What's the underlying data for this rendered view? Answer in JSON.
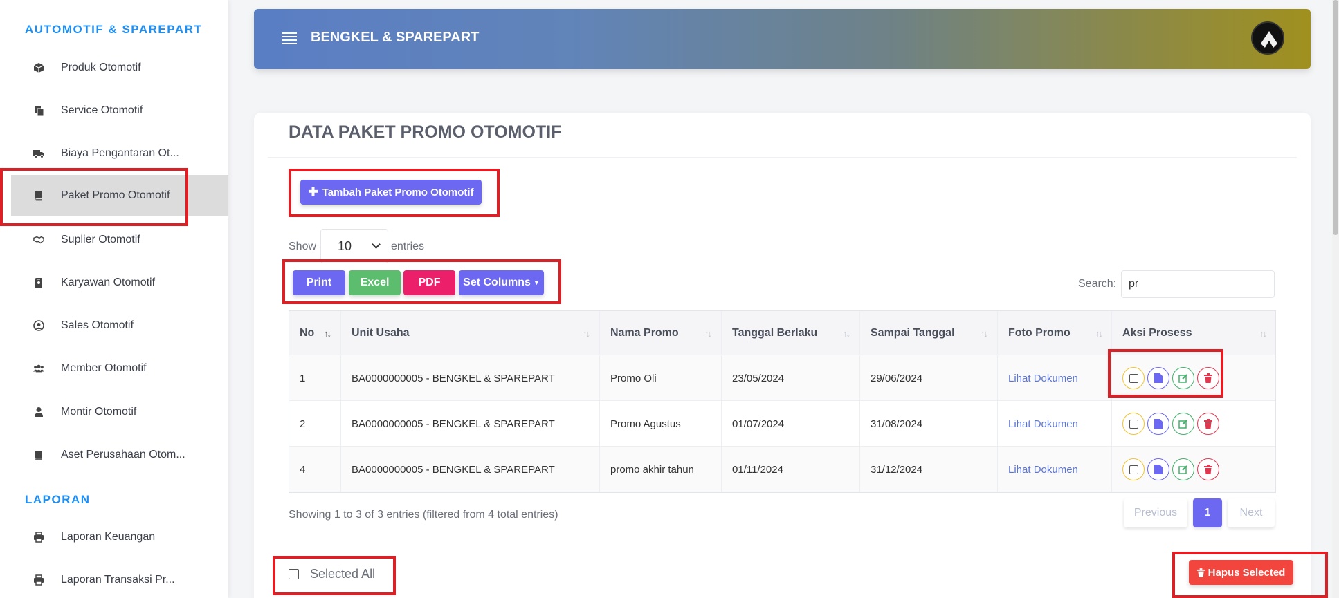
{
  "sidebar": {
    "sections": [
      {
        "title": "AUTOMOTIF & SPAREPART"
      },
      {
        "title": "LAPORAN"
      }
    ],
    "items": [
      {
        "label": "Produk Otomotif",
        "icon": "box-icon"
      },
      {
        "label": "Service Otomotif",
        "icon": "copy-icon"
      },
      {
        "label": "Biaya Pengantaran Ot...",
        "icon": "truck-icon"
      },
      {
        "label": "Paket Promo Otomotif",
        "icon": "book-icon"
      },
      {
        "label": "Suplier Otomotif",
        "icon": "handshake-icon"
      },
      {
        "label": "Karyawan Otomotif",
        "icon": "id-badge-icon"
      },
      {
        "label": "Sales Otomotif",
        "icon": "user-circle-icon"
      },
      {
        "label": "Member Otomotif",
        "icon": "users-icon"
      },
      {
        "label": "Montir Otomotif",
        "icon": "user-icon"
      },
      {
        "label": "Aset Perusahaan Otom...",
        "icon": "book-icon"
      },
      {
        "label": "Laporan Keuangan",
        "icon": "print-icon"
      },
      {
        "label": "Laporan Transaksi Pr...",
        "icon": "print-icon"
      }
    ]
  },
  "header": {
    "brand": "BENGKEL & SPAREPART"
  },
  "card": {
    "title": "DATA PAKET PROMO OTOMOTIF",
    "add_button": "Tambah Paket Promo Otomotif",
    "show_label": "Show",
    "entries_label": "entries",
    "entries_value": "10",
    "export": {
      "print": "Print",
      "excel": "Excel",
      "pdf": "PDF",
      "columns": "Set Columns"
    },
    "search_label": "Search:",
    "search_value": "pr",
    "columns": [
      "No",
      "Unit Usaha",
      "Nama Promo",
      "Tanggal Berlaku",
      "Sampai Tanggal",
      "Foto Promo",
      "Aksi Prosess"
    ],
    "rows": [
      {
        "no": "1",
        "unit": "BA0000000005 - BENGKEL & SPAREPART",
        "nama": "Promo Oli",
        "mulai": "23/05/2024",
        "sampai": "29/06/2024",
        "foto": "Lihat Dokumen"
      },
      {
        "no": "2",
        "unit": "BA0000000005 - BENGKEL & SPAREPART",
        "nama": "Promo Agustus",
        "mulai": "01/07/2024",
        "sampai": "31/08/2024",
        "foto": "Lihat Dokumen"
      },
      {
        "no": "4",
        "unit": "BA0000000005 - BENGKEL & SPAREPART",
        "nama": "promo akhir tahun",
        "mulai": "01/11/2024",
        "sampai": "31/12/2024",
        "foto": "Lihat Dokumen"
      }
    ],
    "info": "Showing 1 to 3 of 3 entries (filtered from 4 total entries)",
    "pagination": {
      "prev": "Previous",
      "current": "1",
      "next": "Next"
    },
    "selected_all": "Selected All",
    "delete_selected": "Hapus Selected"
  },
  "colors": {
    "accent": "#6c68f1",
    "sidebar_section": "#1f8ef1",
    "highlight": "#dd1f26"
  }
}
